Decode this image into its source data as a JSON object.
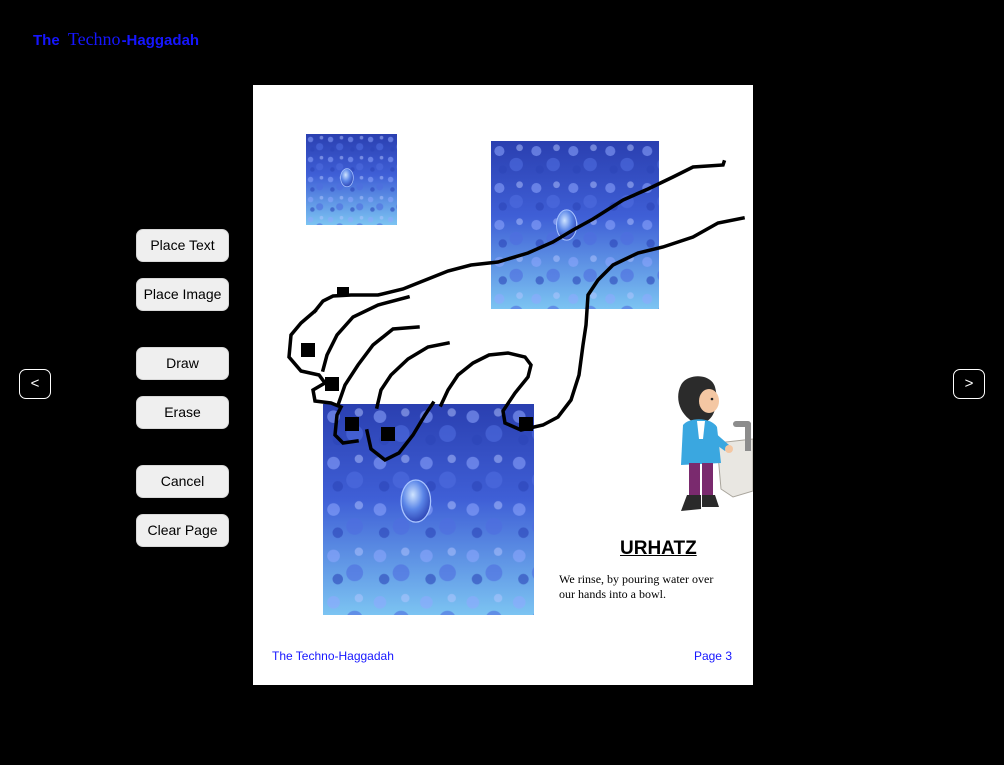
{
  "app": {
    "title_part1": "The",
    "title_part2": "Techno",
    "title_part3": "-Haggadah"
  },
  "nav": {
    "prev_label": "<",
    "next_label": ">"
  },
  "toolbar": {
    "place_text": "Place Text",
    "place_image": "Place Image",
    "draw": "Draw",
    "erase": "Erase",
    "cancel": "Cancel",
    "clear_page": "Clear Page"
  },
  "page": {
    "heading": "URHATZ",
    "body": "We rinse, by pouring water over our hands into a bowl.",
    "footer_title": "The Techno-Haggadah",
    "footer_page": "Page 3"
  },
  "colors": {
    "accent": "#1616ff",
    "background": "#000000",
    "page": "#ffffff",
    "button": "#efefef"
  },
  "icons": {
    "images": "water-droplet-image",
    "drawing": "hand-drawing",
    "sticker": "figure-washing-hands"
  }
}
